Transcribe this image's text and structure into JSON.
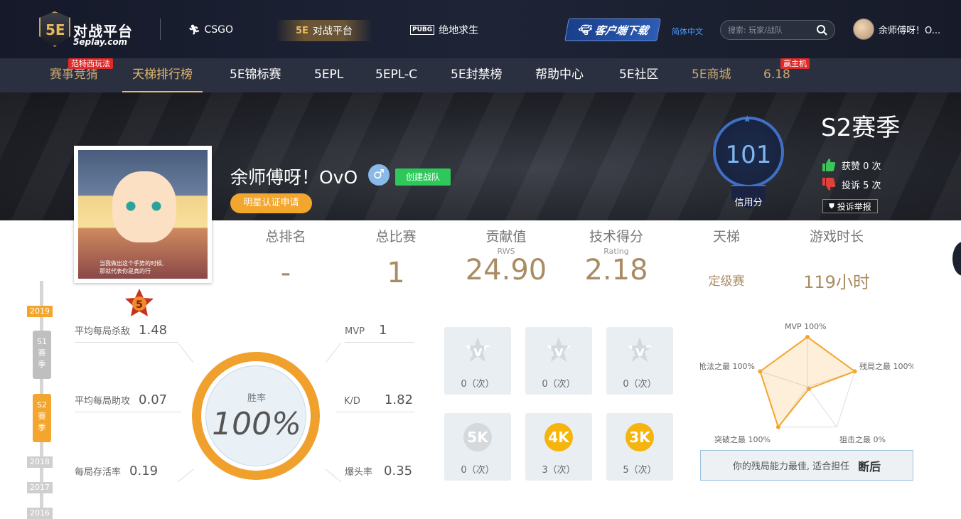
{
  "logo": {
    "badge": "5E",
    "title": "对战平台",
    "subtitle": "5eplay.com"
  },
  "game_tabs": [
    {
      "label": "CSGO",
      "icon": "soldier-icon"
    },
    {
      "label": "对战平台",
      "icon": "5e-icon",
      "active": true
    },
    {
      "label": "绝地求生",
      "icon": "pubg-icon"
    }
  ],
  "header": {
    "download_label": "客户端下载",
    "language": "简体中文",
    "search_placeholder": "搜索: 玩家/战队",
    "username": "余师傅呀！O..."
  },
  "nav": {
    "items": [
      "赛事竞猜",
      "天梯排行榜",
      "5E锦标赛",
      "5EPL",
      "5EPL-C",
      "5E封禁榜",
      "帮助中心",
      "5E社区",
      "5E商城",
      "6.18"
    ],
    "tags": {
      "bet": "范特西玩法",
      "sale": "赢主机"
    }
  },
  "profile": {
    "name": "余师傅呀！OvO",
    "gender_symbol": "♂",
    "team_button": "创建战队",
    "celebrity_button": "明星认证申请",
    "avatar_caption": [
      "当我做出这个手势的时候,",
      "那就代表你是真的行"
    ],
    "credit": {
      "value": "101",
      "label": "信用分"
    },
    "season": "S2赛季",
    "likes_label": "获赞 0 次",
    "complaints_label": "投诉 5 次",
    "report_button": "投诉举报"
  },
  "summary": [
    {
      "label": "总排名",
      "sub": "",
      "value": "-"
    },
    {
      "label": "总比赛",
      "sub": "",
      "value": "1"
    },
    {
      "label": "贡献值",
      "sub": "RWS",
      "value": "24.90"
    },
    {
      "label": "技术得分",
      "sub": "Rating",
      "value": "2.18"
    },
    {
      "label": "天梯",
      "sub": "",
      "value": "定级赛"
    },
    {
      "label": "游戏时长",
      "sub": "",
      "value": "119小时"
    }
  ],
  "timeline": {
    "years": [
      "2019",
      "2018",
      "2017",
      "2016"
    ],
    "seasons": [
      "S1\n赛\n季",
      "S2\n赛\n季"
    ]
  },
  "stats": {
    "rank_badge": "5",
    "avg_kills_label": "平均每局杀敌",
    "avg_kills": "1.48",
    "avg_assists_label": "平均每局助攻",
    "avg_assists": "0.07",
    "survival_label": "每局存活率",
    "survival": "0.19",
    "mvp_label": "MVP",
    "mvp": "1",
    "kd_label": "K/D",
    "kd": "1.82",
    "hs_label": "爆头率",
    "hs": "0.35",
    "win_label": "胜率",
    "win_rate": "100%"
  },
  "clutches": [
    {
      "badge": "1v5",
      "count": "0（次）",
      "style": "star"
    },
    {
      "badge": "1v4",
      "count": "0（次）",
      "style": "star"
    },
    {
      "badge": "1v3",
      "count": "0（次）",
      "style": "star"
    },
    {
      "badge": "5K",
      "count": "0（次）",
      "style": "circ"
    },
    {
      "badge": "4K",
      "count": "3（次）",
      "style": "gold"
    },
    {
      "badge": "3K",
      "count": "5（次）",
      "style": "gold"
    }
  ],
  "radar": {
    "labels": [
      "MVP 100%",
      "残局之最 100%",
      "狙击之最 0%",
      "突破之最 100%",
      "枪法之最 100%"
    ],
    "values": [
      1,
      1,
      0,
      1,
      1
    ],
    "note": "你的残局能力最佳, 适合担任",
    "role": "断后"
  },
  "colors": {
    "accent": "#f3a62e",
    "gold_text": "#a98c63",
    "nav_bg": "#2b3040",
    "credit_blue": "#3f6fc6"
  }
}
